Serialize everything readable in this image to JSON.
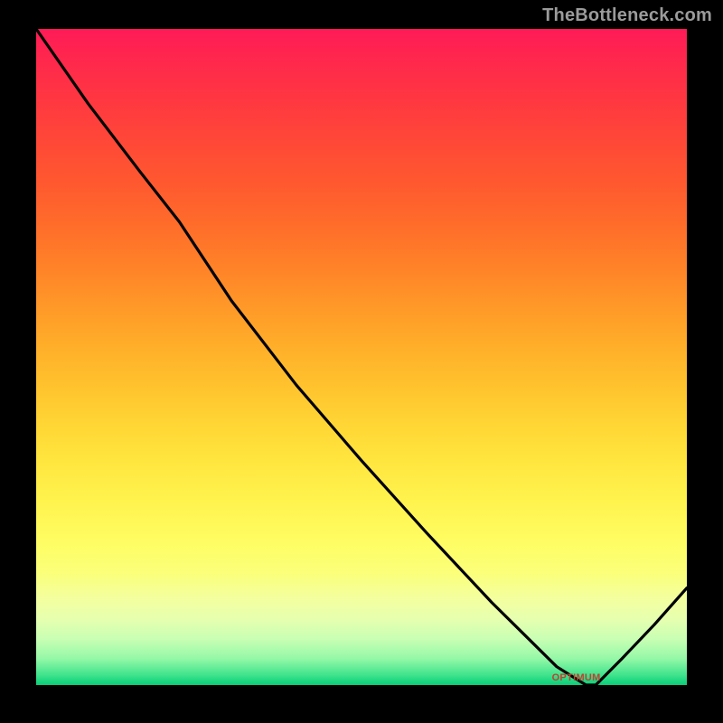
{
  "attribution": "TheBottleneck.com",
  "optimal_label": "OPTIMUM",
  "chart_data": {
    "type": "line",
    "title": "",
    "xlabel": "",
    "ylabel": "",
    "x": [
      0.0,
      0.08,
      0.16,
      0.22,
      0.3,
      0.4,
      0.5,
      0.6,
      0.7,
      0.8,
      0.845,
      0.86,
      0.9,
      0.95,
      1.0
    ],
    "values": [
      1.0,
      0.886,
      0.782,
      0.706,
      0.586,
      0.457,
      0.342,
      0.232,
      0.126,
      0.028,
      0.0,
      0.0,
      0.04,
      0.092,
      0.148
    ],
    "xlim": [
      0,
      1
    ],
    "ylim": [
      0,
      1
    ],
    "optimal_x_range": [
      0.8,
      0.86
    ]
  },
  "colors": {
    "curve": "#000000",
    "optimal_text": "#c14032",
    "attribution_text": "#9b9b9b",
    "background": "#000000"
  }
}
